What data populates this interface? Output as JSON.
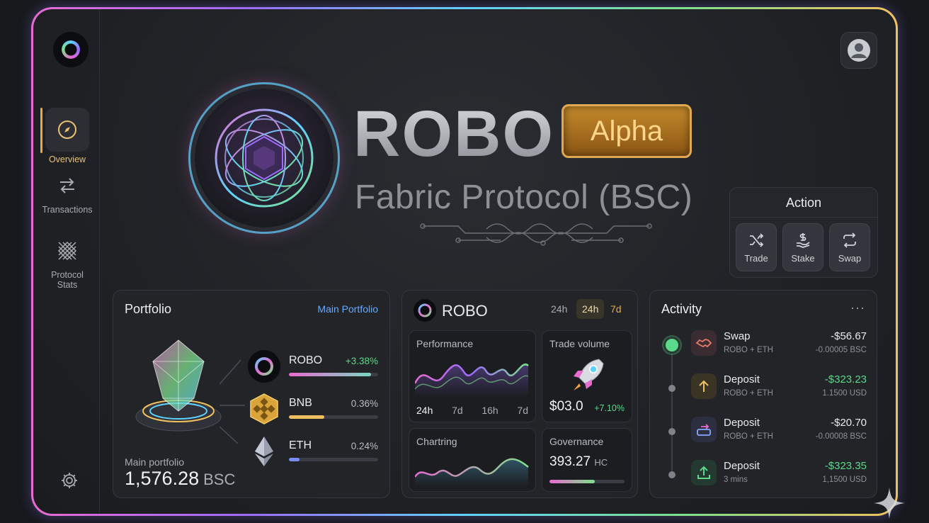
{
  "sidebar": {
    "items": [
      {
        "label": "Overview",
        "icon": "compass-icon",
        "active": true
      },
      {
        "label": "Transactions",
        "icon": "arrows-swap-icon",
        "active": false
      },
      {
        "label": "Protocol Stats",
        "icon": "grid-pattern-icon",
        "active": false
      }
    ],
    "settings_icon": "gear-icon"
  },
  "hero": {
    "title": "ROBO",
    "badge": "Alpha",
    "subtitle": "Fabric Protocol (BSC)"
  },
  "action": {
    "title": "Action",
    "buttons": [
      {
        "label": "Trade",
        "icon": "shuffle-icon"
      },
      {
        "label": "Stake",
        "icon": "dollar-hand-icon"
      },
      {
        "label": "Swap",
        "icon": "swap-cycle-icon"
      }
    ]
  },
  "portfolio": {
    "title": "Portfolio",
    "link": "Main Portfolio",
    "assets": [
      {
        "name": "ROBO",
        "pct": "+3.38%",
        "level": 0.92,
        "color": "#7ad7c0"
      },
      {
        "name": "BNB",
        "pct": "0.36%",
        "level": 0.4,
        "color": "#f0c060"
      },
      {
        "name": "ETH",
        "pct": "0.24%",
        "level": 0.12,
        "color": "#7a8cff"
      }
    ],
    "total_label": "Main portfolio",
    "total_value": "1,576.28",
    "total_unit": "BSC"
  },
  "robo": {
    "title": "ROBO",
    "timeframes": [
      "24h",
      "24h",
      "7d"
    ],
    "performance": {
      "title": "Performance",
      "ticks": [
        "24h",
        "7d",
        "16h",
        "7d"
      ]
    },
    "trade_volume": {
      "title": "Trade volume",
      "value": "$03.0",
      "change": "+7.10%"
    },
    "chartring": {
      "title": "Chartring"
    },
    "governance": {
      "title": "Governance",
      "value": "393.27",
      "unit": "HC",
      "level": 0.6
    }
  },
  "activity": {
    "title": "Activity",
    "more": "···",
    "rows": [
      {
        "title": "Swap",
        "sub": "ROBO + ETH",
        "value": "-$56.67",
        "value_sub": "-0.00005 BSC",
        "positive": false,
        "icon": "handshake-icon"
      },
      {
        "title": "Deposit",
        "sub": "ROBO + ETH",
        "value": "-$323.23",
        "value_sub": "1.1500 USD",
        "positive": true,
        "icon": "arrow-up-icon"
      },
      {
        "title": "Deposit",
        "sub": "ROBO + ETH",
        "value": "-$20.70",
        "value_sub": "-0.00008 BSC",
        "positive": false,
        "icon": "transfer-icon"
      },
      {
        "title": "Deposit",
        "sub": "3 mins",
        "value": "-$323.35",
        "value_sub": "1,1500 USD",
        "positive": true,
        "icon": "upload-icon"
      }
    ]
  },
  "colors": {
    "accent_gold": "#e9a94a",
    "positive": "#5bd98a",
    "link": "#6aa8ff"
  }
}
